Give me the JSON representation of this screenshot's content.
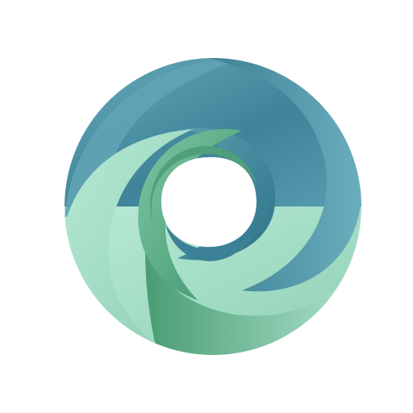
{
  "logo": {
    "icon": "swirl-logo-icon",
    "colors": {
      "teal_dark": "#3f8399",
      "teal_mid": "#5fa3b4",
      "teal_light": "#7bb8c6",
      "green_dark": "#4d9e78",
      "green_mid": "#74c09c",
      "mint_light": "#a9e1cc",
      "background": "#ffffff"
    }
  }
}
